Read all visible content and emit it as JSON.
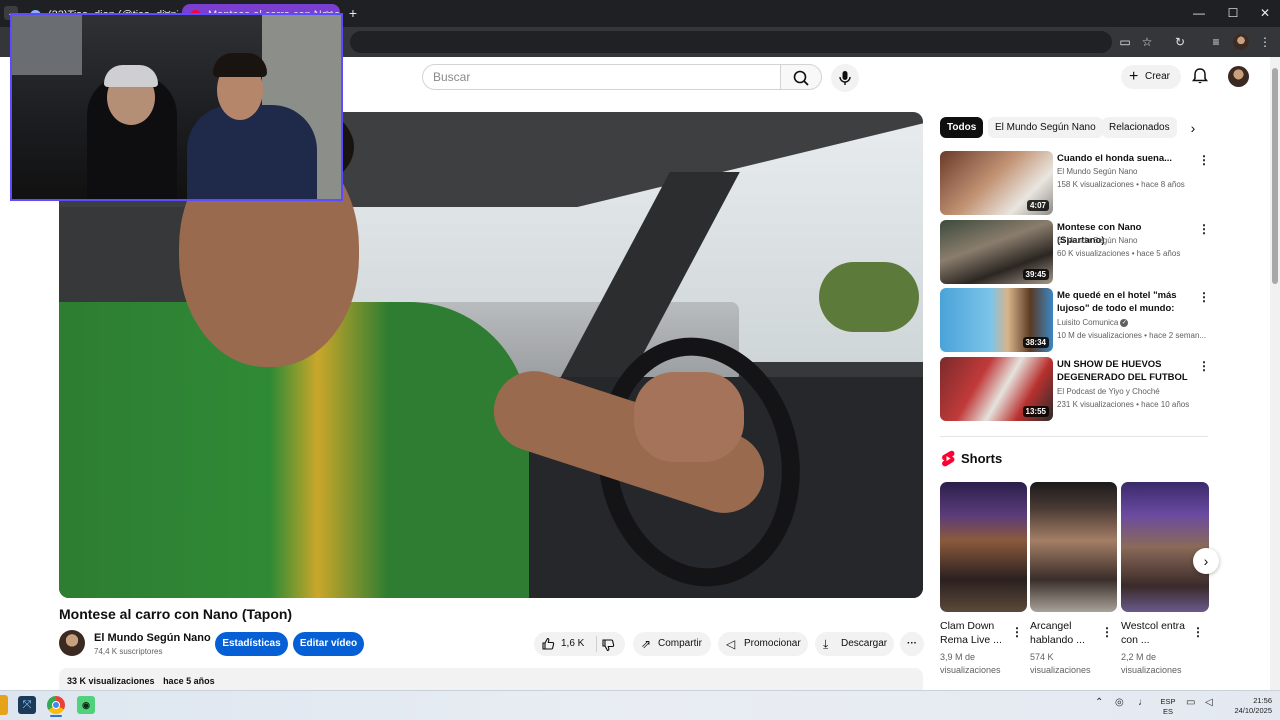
{
  "browser": {
    "tabs": [
      {
        "title": "(23)Tiso_dion (@tiso_dion) | ...",
        "state": "inactive"
      },
      {
        "title": "Montese al carro con Nano (T...",
        "state": "active"
      }
    ],
    "new_tab_label": "+",
    "window_controls": {
      "minimize": "—",
      "maximize": "☐",
      "close": "✕"
    }
  },
  "header": {
    "search_placeholder": "Buscar",
    "create_label": "Crear"
  },
  "video": {
    "title": "Montese al carro con Nano (Tapon)",
    "channel": "El Mundo Según Nano",
    "subscribers": "74,4 K suscriptores",
    "stats_button": "Estadísticas",
    "edit_button": "Editar vídeo",
    "likes": "1,6 K",
    "share": "Compartir",
    "promote": "Promocionar",
    "download": "Descargar",
    "more": "···",
    "views": "33 K visualizaciones",
    "age": "hace 5 años"
  },
  "chips": [
    "Todos",
    "El Mundo Según Nano",
    "Relacionados"
  ],
  "related": [
    {
      "title": "Cuando el honda suena...",
      "channel": "El Mundo Según Nano",
      "meta": "158 K visualizaciones • hace 8 años",
      "duration": "4:07",
      "verified": false
    },
    {
      "title": "Montese con Nano (Spartano)",
      "channel": "El Mundo Según Nano",
      "meta": "60 K visualizaciones • hace 5 años",
      "duration": "39:45",
      "verified": false
    },
    {
      "title": "Me quedé en el hotel \"más lujoso\" de todo el mundo: ¿es ...",
      "channel": "Luisito Comunica",
      "meta": "10 M de visualizaciones • hace 2 seman...",
      "duration": "38:34",
      "verified": true
    },
    {
      "title": "UN SHOW DE HUEVOS DEGENERADO DEL FUTBOL",
      "channel": "El Podcast de Yiyo y Choché",
      "meta": "231 K visualizaciones • hace 10 años",
      "duration": "13:55",
      "verified": false
    }
  ],
  "shorts": {
    "title": "Shorts",
    "items": [
      {
        "title": "Clam Down Rema Live ...",
        "views": "3,9 M de visualizaciones"
      },
      {
        "title": "Arcangel hablando ...",
        "views": "574 K visualizaciones"
      },
      {
        "title": "Westcol entra con ...",
        "views": "2,2 M de visualizaciones"
      }
    ]
  },
  "taskbar": {
    "lang_top": "ESP",
    "lang_bottom": "ES",
    "time": "21:56",
    "date": "24/10/2025"
  },
  "colors": {
    "brand_red": "#ff0033",
    "primary_blue": "#065fd4",
    "webcam_border": "#5b4cff"
  }
}
